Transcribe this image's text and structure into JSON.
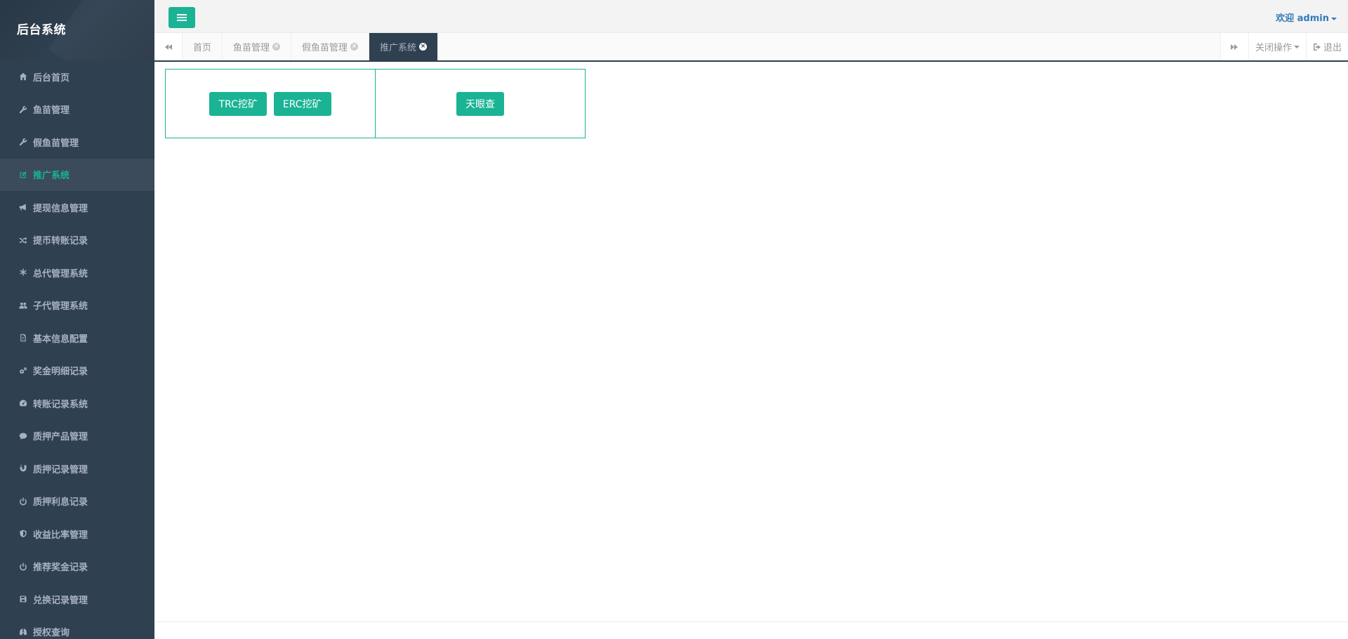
{
  "app": {
    "brand": "后台系统"
  },
  "sidebar": {
    "items": [
      {
        "label": "后台首页",
        "icon": "home-icon"
      },
      {
        "label": "鱼苗管理",
        "icon": "wrench-icon"
      },
      {
        "label": "假鱼苗管理",
        "icon": "wrench-icon"
      },
      {
        "label": "推广系统",
        "icon": "edit-icon",
        "active": true
      },
      {
        "label": "提现信息管理",
        "icon": "bullhorn-icon"
      },
      {
        "label": "提币转账记录",
        "icon": "random-icon"
      },
      {
        "label": "总代管理系统",
        "icon": "asterisk-icon"
      },
      {
        "label": "子代管理系统",
        "icon": "users-icon"
      },
      {
        "label": "基本信息配置",
        "icon": "file-icon"
      },
      {
        "label": "奖金明细记录",
        "icon": "cogs-icon"
      },
      {
        "label": "转账记录系统",
        "icon": "dashboard-icon"
      },
      {
        "label": "质押产品管理",
        "icon": "comment-icon"
      },
      {
        "label": "质押记录管理",
        "icon": "magnet-icon"
      },
      {
        "label": "质押利息记录",
        "icon": "power-icon"
      },
      {
        "label": "收益比率管理",
        "icon": "shield-icon"
      },
      {
        "label": "推荐奖金记录",
        "icon": "power-icon"
      },
      {
        "label": "兑换记录管理",
        "icon": "save-icon"
      },
      {
        "label": "授权查询",
        "icon": "binoculars-icon"
      }
    ]
  },
  "header": {
    "welcome": "欢迎 admin"
  },
  "tabs": [
    {
      "label": "首页",
      "closable": false
    },
    {
      "label": "鱼苗管理",
      "closable": true
    },
    {
      "label": "假鱼苗管理",
      "closable": true
    },
    {
      "label": "推广系统",
      "closable": true,
      "active": true
    }
  ],
  "tabbar": {
    "close_ops": "关闭操作",
    "logout": "退出"
  },
  "content": {
    "panels": [
      {
        "buttons": [
          "TRC挖矿",
          "ERC挖矿"
        ]
      },
      {
        "buttons": [
          "天眼查"
        ]
      }
    ]
  },
  "colors": {
    "sidebar_bg": "#2f4050",
    "accent": "#1ab394",
    "link": "#337ab7"
  }
}
